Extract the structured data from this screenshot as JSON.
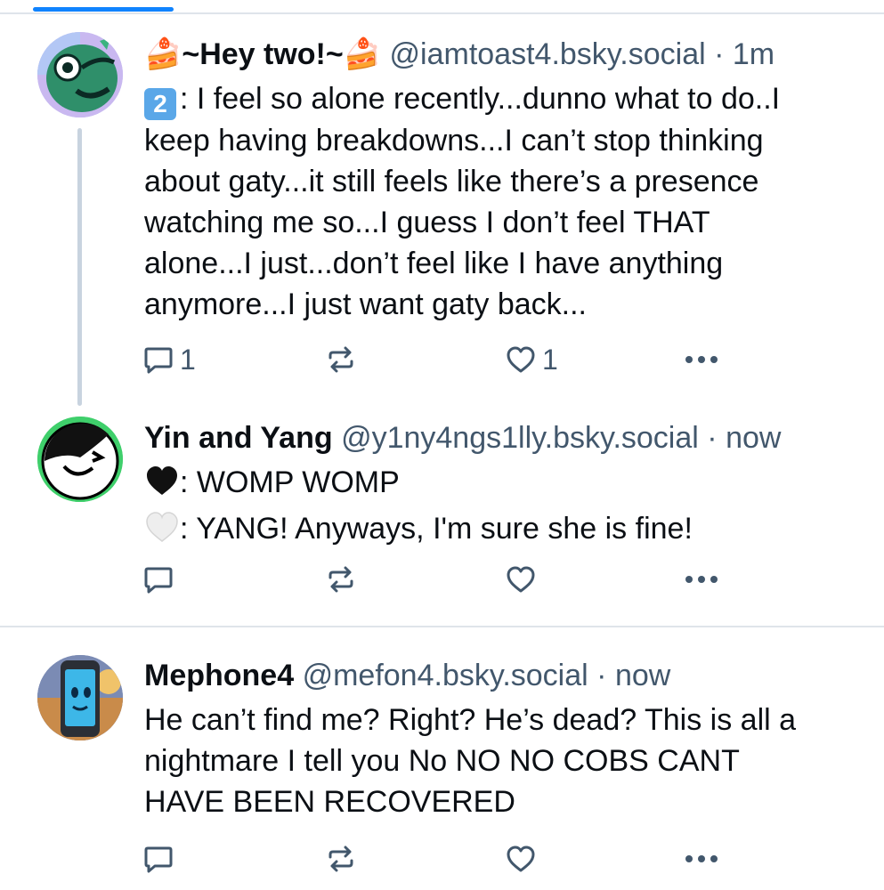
{
  "posts": [
    {
      "display_name": "~Hey two!~",
      "name_prefix_emoji": "🍰",
      "name_suffix_emoji": "🍰",
      "handle": "@iamtoast4.bsky.social",
      "separator": "·",
      "time": "1m",
      "lines": [
        {
          "prefix": "2",
          "text": ": I feel so alone recently...dunno what to do..I"
        },
        {
          "text": "keep having breakdowns...I can’t stop thinking"
        },
        {
          "text": "about gaty...it still feels like there’s a presence"
        },
        {
          "text": "watching me so...I guess I don’t feel THAT"
        },
        {
          "text": "alone...I just...don’t feel like I have anything"
        },
        {
          "text": "anymore...I just want gaty back..."
        }
      ],
      "reply_count": "1",
      "repost_count": "",
      "like_count": "1",
      "avatar_icon": "green-character-avatar"
    },
    {
      "display_name": "Yin and Yang",
      "handle": "@y1ny4ngs1lly.bsky.social",
      "separator": "·",
      "time": "now",
      "lines": [
        {
          "emoji": "🖤",
          "text": ": WOMP WOMP"
        },
        {
          "emoji": "🤍",
          "text": ": YANG! Anyways, I'm sure she is fine!"
        }
      ],
      "reply_count": "",
      "repost_count": "",
      "like_count": "",
      "avatar_icon": "yin-yang-character-avatar"
    },
    {
      "display_name": "Mephone4",
      "handle": "@mefon4.bsky.social",
      "separator": "·",
      "time": "now",
      "lines": [
        {
          "text": "He can’t find me? Right? He’s dead? This is all a"
        },
        {
          "text": "nightmare I tell you No NO NO COBS CANT"
        },
        {
          "text": "HAVE BEEN RECOVERED"
        }
      ],
      "reply_count": "",
      "repost_count": "",
      "like_count": "",
      "avatar_icon": "phone-character-avatar"
    }
  ],
  "icons": {
    "reply": "reply-icon",
    "repost": "repost-icon",
    "like": "heart-icon",
    "more": "more-options-icon"
  },
  "colors": {
    "accent": "#1083fe",
    "muted": "#42576c",
    "thread_line": "#c8d3df",
    "divider": "#dfe4ea"
  }
}
